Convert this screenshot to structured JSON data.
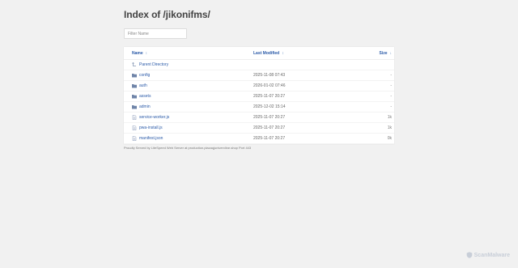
{
  "page": {
    "title": "Index of /jikonifms/",
    "filter_placeholder": "Filter Name"
  },
  "table": {
    "headers": {
      "name": "Name",
      "name_sort": "↕",
      "modified": "Last Modified",
      "modified_sort": "↕",
      "size": "Size",
      "size_sort": "↓"
    },
    "parent": {
      "label": "Parent Directory",
      "icon": "up-arrow-icon"
    },
    "rows": [
      {
        "name": "config",
        "type": "folder",
        "modified": "2025-11-08 07:43",
        "size": "-"
      },
      {
        "name": "auth",
        "type": "folder",
        "modified": "2026-01-02 07:46",
        "size": "-"
      },
      {
        "name": "assets",
        "type": "folder",
        "modified": "2025-11-07 20:27",
        "size": "-"
      },
      {
        "name": "admin",
        "type": "folder",
        "modified": "2025-12-02 15:14",
        "size": "-"
      },
      {
        "name": "service-worker.js",
        "type": "file",
        "modified": "2025-11-07 20:27",
        "size": "1k"
      },
      {
        "name": "pwa-install.js",
        "type": "file",
        "modified": "2025-11-07 20:27",
        "size": "1k"
      },
      {
        "name": "manifest.json",
        "type": "file",
        "modified": "2025-11-07 20:27",
        "size": "0k"
      }
    ]
  },
  "footer": "Proudly Served by LiteSpeed Web Server at production.plazaqjuniverxline.shop Port 443",
  "watermark": "ScanMalware",
  "colors": {
    "link": "#2a5aa8",
    "background": "#f1f1f1",
    "folder": "#6f84a8"
  }
}
